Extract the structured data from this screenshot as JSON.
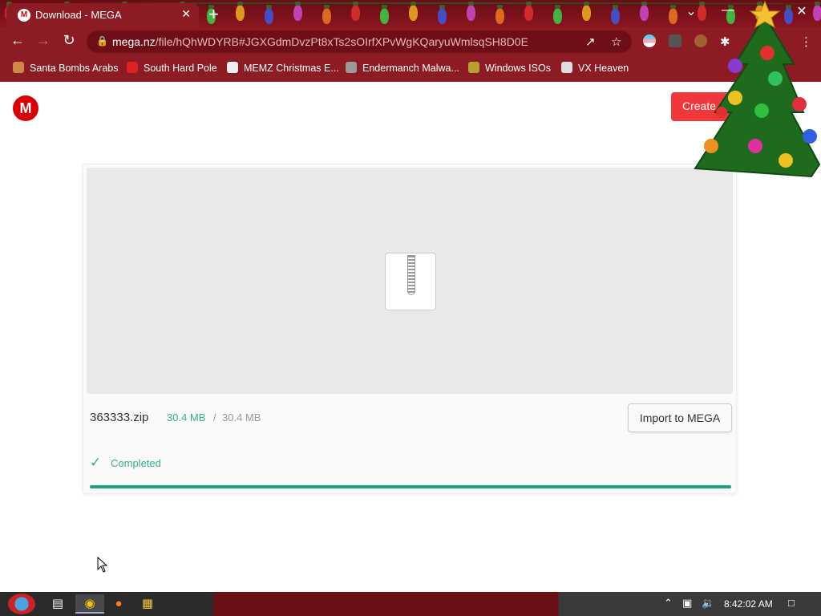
{
  "browser": {
    "tab_title": "Download - MEGA",
    "tab_favicon": "M",
    "tab_close": "✕",
    "new_tab": "+",
    "url_host": "mega.nz",
    "url_path": "/file/hQhWDYRB#JGXGdmDvzPt8xTs2sOIrfXPvWgKQaryuWmlsqSH8D0E"
  },
  "bookmarks": [
    {
      "label": "Santa Bombs Arabs",
      "icon": "santa-icon"
    },
    {
      "label": "South Hard Pole",
      "icon": "snowflake-icon"
    },
    {
      "label": "MEMZ Christmas E...",
      "icon": "memz-icon"
    },
    {
      "label": "Endermanch Malwa...",
      "icon": "raccoon-icon"
    },
    {
      "label": "Windows ISOs",
      "icon": "tree-icon"
    },
    {
      "label": "VX Heaven",
      "icon": "heaven-icon"
    }
  ],
  "mega": {
    "logo": "M",
    "create_label": "Create",
    "file_name": "363333.zip",
    "size_downloaded": "30.4 MB",
    "size_separator": "/",
    "size_total": "30.4 MB",
    "import_label": "Import to MEGA",
    "status_label": "Completed",
    "progress_fraction": 1.0
  },
  "taskbar": {
    "clock": "8:42:02 AM"
  },
  "colors": {
    "accent": "#31b37f",
    "mega_red": "#d90007",
    "chrome_bg": "#8d1b24"
  }
}
